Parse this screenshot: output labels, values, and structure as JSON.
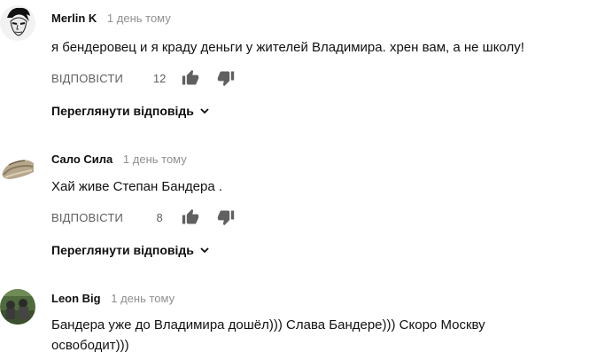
{
  "comments": [
    {
      "author": "Merlin K",
      "time": "1 день тому",
      "text": "я бендеровец и я краду деньги у жителей Владимира. хрен вам, а не школу!",
      "reply_label": "ВІДПОВІСТИ",
      "likes": "12",
      "view_replies_label": "Переглянути відповідь",
      "avatar_icon": "face-sketch-icon"
    },
    {
      "author": "Сало Сила",
      "time": "1 день тому",
      "text": "Хай живе Степан Бандера .",
      "reply_label": "ВІДПОВІСТИ",
      "likes": "8",
      "view_replies_label": "Переглянути відповідь",
      "avatar_icon": "salo-icon"
    },
    {
      "author": "Leon Big",
      "time": "1 день тому",
      "text_line1": "Бандера уже до Владимира дошёл))) Слава Бандере))) Скоро Москву",
      "text_line2": "освободит)))",
      "avatar_icon": "photo-avatar-icon"
    }
  ],
  "colors": {
    "text_primary": "#0f0f0f",
    "text_secondary": "#909090",
    "action_grey": "#606060",
    "icon_grey": "#606060"
  }
}
